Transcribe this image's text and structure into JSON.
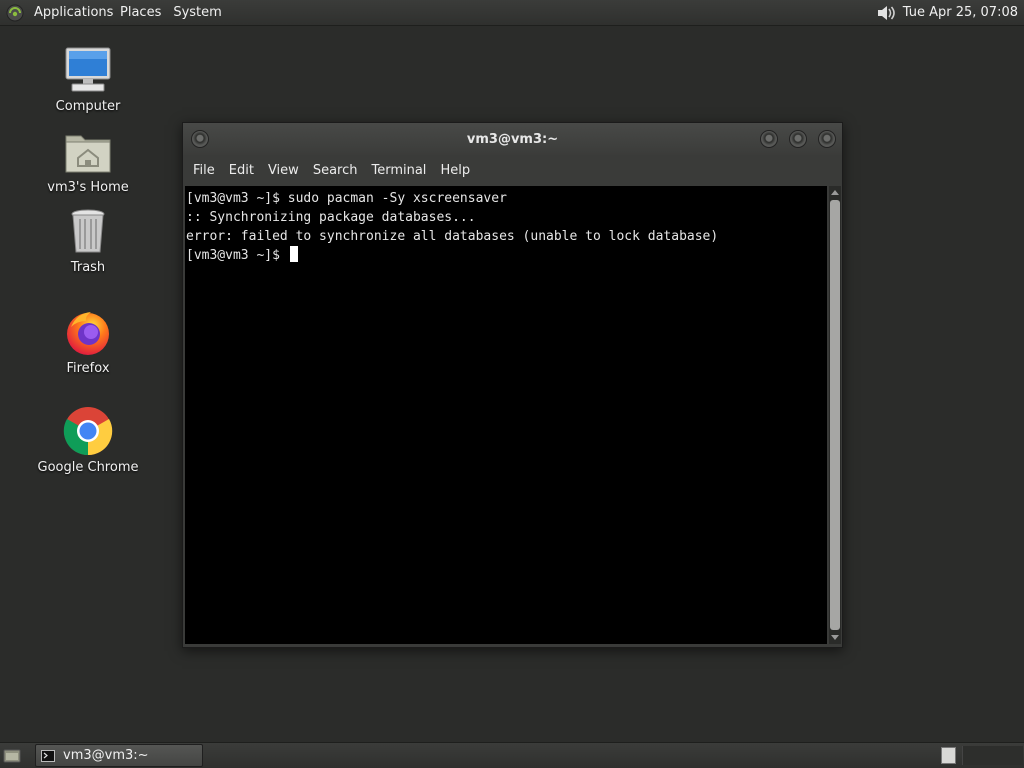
{
  "top_panel": {
    "menus": [
      "Applications",
      "Places",
      "System"
    ],
    "clock": "Tue Apr 25, 07:08"
  },
  "desktop": {
    "icons": [
      {
        "label": "Computer",
        "icon": "computer-icon"
      },
      {
        "label": "vm3's Home",
        "icon": "home-folder-icon"
      },
      {
        "label": "Trash",
        "icon": "trash-icon"
      },
      {
        "label": "Firefox",
        "icon": "firefox-icon"
      },
      {
        "label": "Google Chrome",
        "icon": "chrome-icon"
      }
    ]
  },
  "terminal": {
    "title": "vm3@vm3:~",
    "menu": [
      "File",
      "Edit",
      "View",
      "Search",
      "Terminal",
      "Help"
    ],
    "lines": [
      "[vm3@vm3 ~]$ sudo pacman -Sy xscreensaver",
      ":: Synchronizing package databases...",
      "error: failed to synchronize all databases (unable to lock database)"
    ],
    "prompt": "[vm3@vm3 ~]$ "
  },
  "taskbar": {
    "tasks": [
      {
        "label": "vm3@vm3:~",
        "icon": "terminal-icon"
      }
    ]
  },
  "colors": {
    "desktop_bg": "#2b2c2a",
    "terminal_bg": "#000000",
    "panel_bg": "#353634"
  }
}
